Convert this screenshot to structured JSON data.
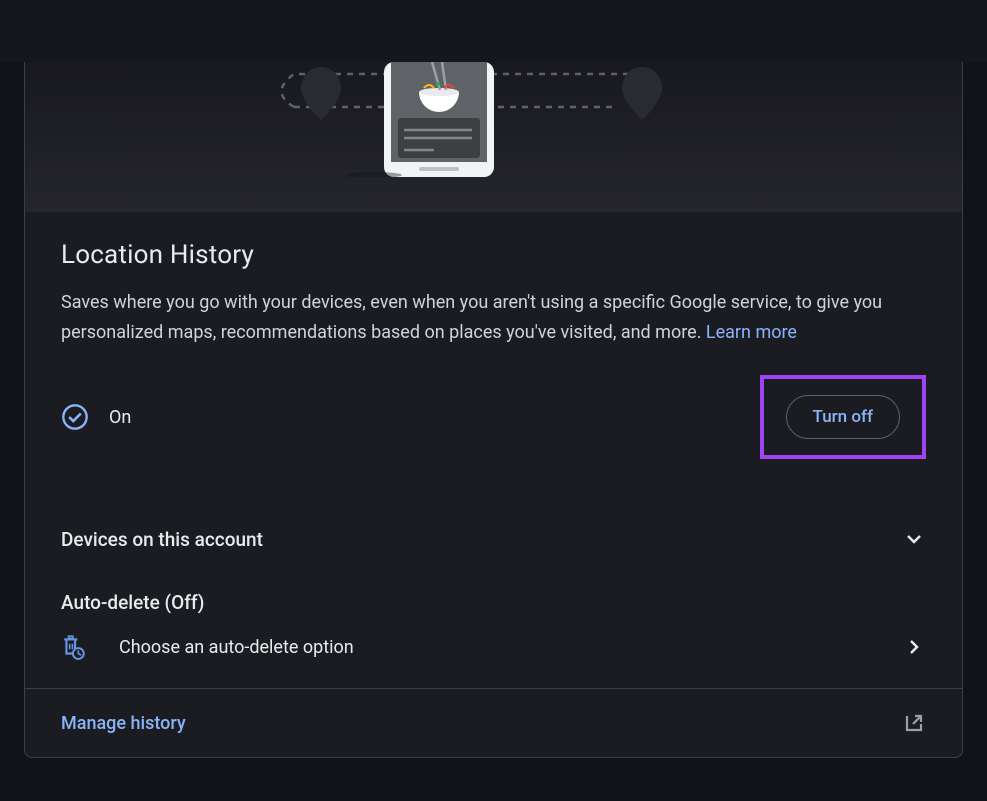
{
  "title": "Location History",
  "description": "Saves where you go with your devices, even when you aren't using a specific Google service, to give you personalized maps, recommendations based on places you've visited, and more. ",
  "learn_more": "Learn more",
  "status": {
    "label": "On",
    "turn_off": "Turn off"
  },
  "devices": {
    "label": "Devices on this account"
  },
  "auto_delete": {
    "title": "Auto-delete (Off)",
    "option": "Choose an auto-delete option"
  },
  "manage": {
    "label": "Manage history"
  }
}
